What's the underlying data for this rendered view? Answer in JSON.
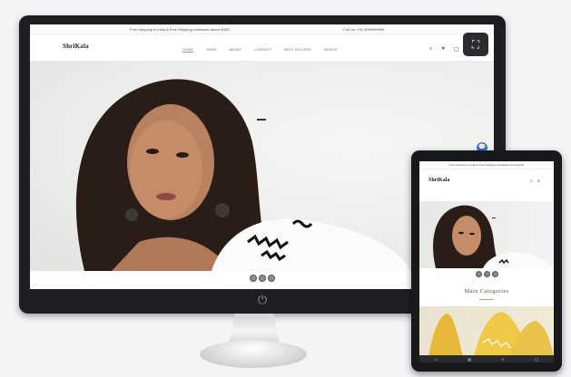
{
  "desktop": {
    "announcement": "Free Shipping in India & Free Shipping worldwide above $150",
    "contact": "Call Us: +91 9999999999",
    "logo": "ShriKala",
    "nav": [
      "HOME",
      "SHOP",
      "ABOUT",
      "CONTACT",
      "BEST SELLERS",
      "NEW IN"
    ],
    "expand_icon": "⛶",
    "chat_icon": "💬",
    "power_icon": "⏻"
  },
  "tablet": {
    "announcement": "Free Shipping in India & Free Shipping worldwide above $150",
    "logo": "ShriKala",
    "category_heading": "Main Categories"
  },
  "colors": {
    "monitor_bezel": "#1c1e22",
    "chat_button": "#2f7fe6",
    "accent": "#c0a070"
  }
}
